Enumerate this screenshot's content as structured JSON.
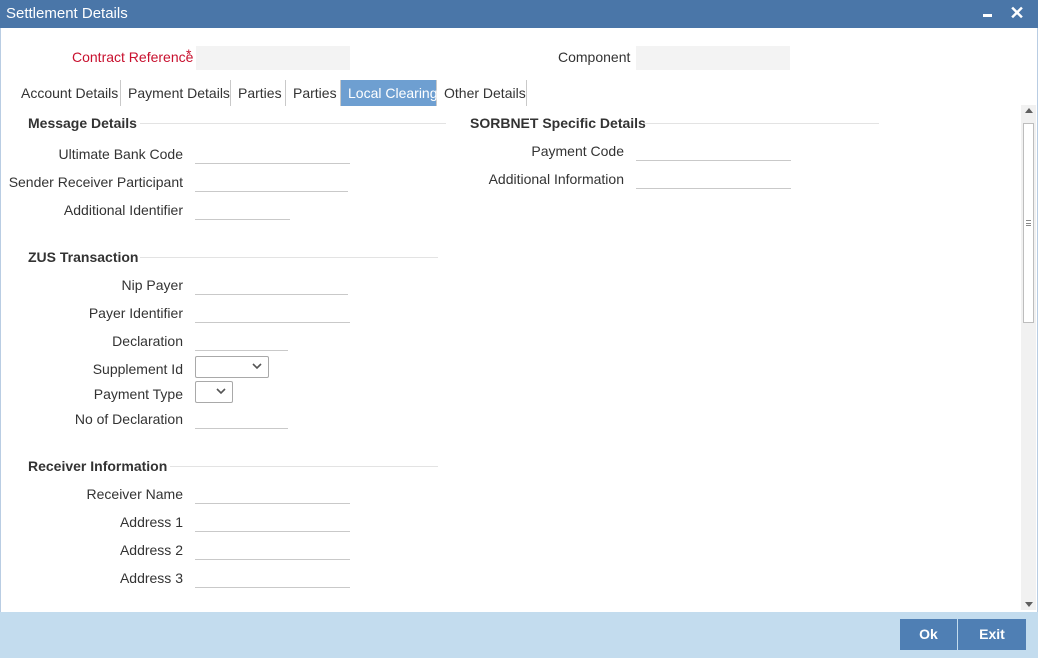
{
  "window": {
    "title": "Settlement Details",
    "minimize_glyph": "",
    "close_glyph": "✕"
  },
  "header": {
    "contract_reference_label": "Contract Reference",
    "required_mark": "*",
    "contract_reference_value": "",
    "component_label": "Component",
    "component_value": ""
  },
  "tabs": [
    {
      "label": "Account Details"
    },
    {
      "label": "Payment Details"
    },
    {
      "label": "Parties"
    },
    {
      "label": "Parties"
    },
    {
      "label": "Local Clearing",
      "active": true
    },
    {
      "label": "Other Details"
    }
  ],
  "message_details": {
    "heading": "Message Details",
    "ultimate_bank_code_label": "Ultimate Bank Code",
    "ultimate_bank_code_value": "",
    "sender_receiver_participant_label": "Sender Receiver Participant",
    "sender_receiver_participant_value": "",
    "additional_identifier_label": "Additional Identifier",
    "additional_identifier_value": ""
  },
  "sorbnet": {
    "heading": "SORBNET Specific Details",
    "payment_code_label": "Payment Code",
    "payment_code_value": "",
    "additional_information_label": "Additional Information",
    "additional_information_value": ""
  },
  "zus": {
    "heading": "ZUS Transaction",
    "nip_payer_label": "Nip Payer",
    "nip_payer_value": "",
    "payer_identifier_label": "Payer Identifier",
    "payer_identifier_value": "",
    "declaration_label": "Declaration",
    "declaration_value": "",
    "supplement_id_label": "Supplement Id",
    "supplement_id_value": "",
    "payment_type_label": "Payment Type",
    "payment_type_value": "",
    "no_of_declaration_label": "No of Declaration",
    "no_of_declaration_value": ""
  },
  "receiver": {
    "heading": "Receiver Information",
    "receiver_name_label": "Receiver Name",
    "receiver_name_value": "",
    "address1_label": "Address 1",
    "address1_value": "",
    "address2_label": "Address 2",
    "address2_value": "",
    "address3_label": "Address 3",
    "address3_value": ""
  },
  "footer": {
    "ok_label": "Ok",
    "exit_label": "Exit"
  },
  "colors": {
    "titlebar": "#4a76a8",
    "active_tab": "#6e9fd1",
    "required_text": "#c8102e",
    "footer": "#c3dcee",
    "button": "#4f7fb4"
  }
}
